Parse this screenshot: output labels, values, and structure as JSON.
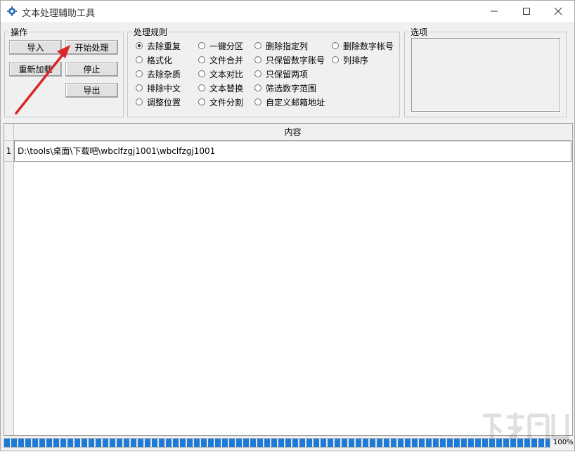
{
  "window": {
    "title": "文本处理辅助工具",
    "icons": {
      "app": "gear-icon",
      "minimize": "minimize-icon",
      "maximize": "maximize-icon",
      "close": "close-icon"
    }
  },
  "operations": {
    "legend": "操作",
    "buttons": {
      "import": "导入",
      "start": "开始处理",
      "reload": "重新加载",
      "stop": "停止",
      "export": "导出"
    }
  },
  "rules": {
    "legend": "处理规则",
    "options": [
      {
        "label": "去除重复",
        "checked": true
      },
      {
        "label": "格式化",
        "checked": false
      },
      {
        "label": "去除杂质",
        "checked": false
      },
      {
        "label": "排除中文",
        "checked": false
      },
      {
        "label": "调整位置",
        "checked": false
      },
      {
        "label": "一键分区",
        "checked": false
      },
      {
        "label": "文件合并",
        "checked": false
      },
      {
        "label": "文本对比",
        "checked": false
      },
      {
        "label": "文本替换",
        "checked": false
      },
      {
        "label": "文件分割",
        "checked": false
      },
      {
        "label": "删除指定列",
        "checked": false
      },
      {
        "label": "只保留数字账号",
        "checked": false
      },
      {
        "label": "只保留两项",
        "checked": false
      },
      {
        "label": "筛选数字范围",
        "checked": false
      },
      {
        "label": "自定义邮箱地址",
        "checked": false
      },
      {
        "label": "删除数字帐号",
        "checked": false
      },
      {
        "label": "列排序",
        "checked": false
      }
    ]
  },
  "options_panel": {
    "legend": "选项"
  },
  "table": {
    "header": "内容",
    "rows": [
      {
        "num": "1",
        "content": "D:\\tools\\桌面\\下载吧\\wbclfzgj1001\\wbclfzgj1001"
      }
    ]
  },
  "progress": {
    "value": 1.0,
    "label": "100%",
    "color": "#1d7ad6"
  },
  "annotation": {
    "arrow_color": "#d9262b"
  }
}
